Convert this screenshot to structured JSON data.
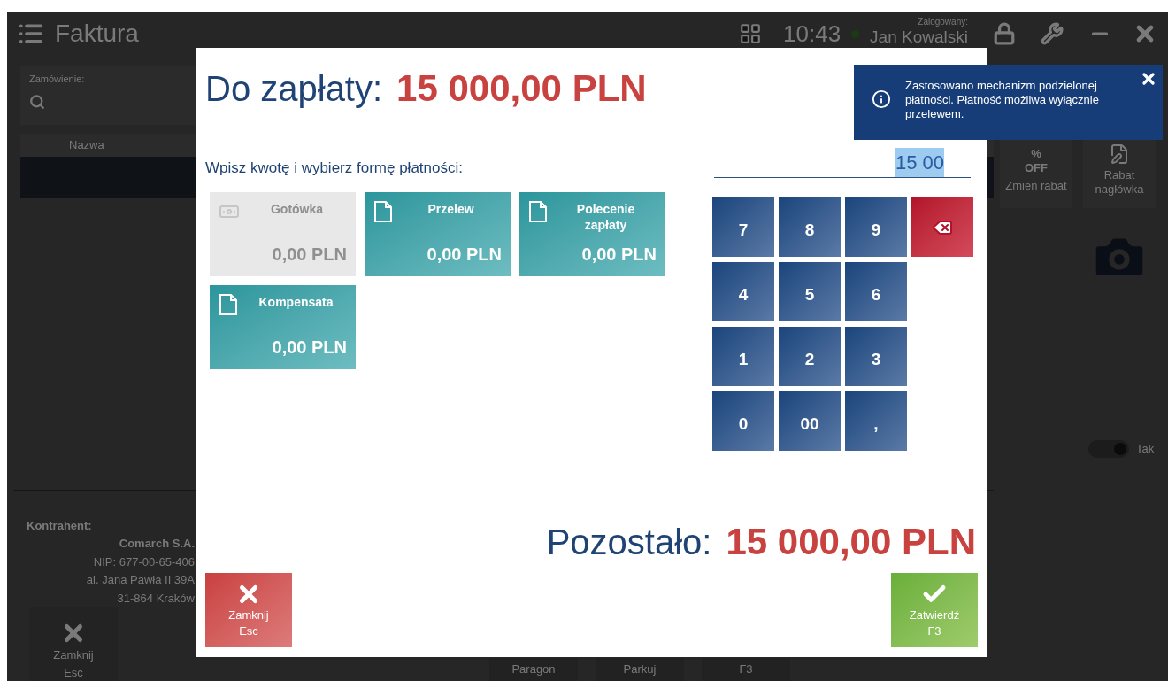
{
  "app": {
    "title": "Faktura",
    "clock": "10:43",
    "user_label": "Zalogowany:",
    "user": "Jan Kowalski",
    "order": {
      "label": "Zamówienie:"
    },
    "table": {
      "columns": [
        "Nazwa"
      ]
    },
    "side_buttons": [
      {
        "kind": "discount",
        "icon_text": [
          "%",
          "OFF"
        ],
        "label": "Zmień rabat"
      },
      {
        "kind": "document",
        "label": "Rabat nagłówka"
      }
    ],
    "toggle": {
      "label": "Tak",
      "on": true
    },
    "customer": {
      "heading": "Kontrahent:",
      "name": "Comarch S.A.",
      "lines": [
        "NIP: 677-00-65-406",
        "al. Jana Pawła II 39A",
        "31-864 Kraków"
      ]
    },
    "close_button": {
      "label": "Zamknij",
      "shortcut": "Esc"
    },
    "bottom_buttons": [
      {
        "label": "Paragon"
      },
      {
        "label": "Parkuj"
      },
      {
        "label": "F3"
      }
    ]
  },
  "dialog": {
    "due_label": "Do zapłaty:",
    "due_amount": "15 000,00",
    "due_currency": "PLN",
    "instruction": "Wpisz kwotę i wybierz formę płatności:",
    "methods": [
      {
        "name": "Gotówka",
        "amount": "0,00 PLN",
        "kind": "cash",
        "disabled": true
      },
      {
        "name": "Przelew",
        "amount": "0,00 PLN",
        "kind": "document",
        "disabled": false
      },
      {
        "name": "Polecenie zapłaty",
        "amount": "0,00 PLN",
        "kind": "document",
        "disabled": false
      },
      {
        "name": "Kompensata",
        "amount": "0,00 PLN",
        "kind": "document",
        "disabled": false
      }
    ],
    "amount_input": {
      "value": "15 00",
      "selected": true
    },
    "keypad": [
      [
        {
          "kind": "digit",
          "label": "7"
        },
        {
          "kind": "digit",
          "label": "8"
        },
        {
          "kind": "digit",
          "label": "9"
        },
        {
          "kind": "backspace"
        }
      ],
      [
        {
          "kind": "digit",
          "label": "4"
        },
        {
          "kind": "digit",
          "label": "5"
        },
        {
          "kind": "digit",
          "label": "6"
        }
      ],
      [
        {
          "kind": "digit",
          "label": "1"
        },
        {
          "kind": "digit",
          "label": "2"
        },
        {
          "kind": "digit",
          "label": "3"
        }
      ],
      [
        {
          "kind": "digit",
          "label": "0"
        },
        {
          "kind": "digit",
          "label": "00"
        },
        {
          "kind": "digit",
          "label": ","
        }
      ]
    ],
    "remaining_label": "Pozostało:",
    "remaining_amount": "15 000,00",
    "remaining_currency": "PLN",
    "buttons": [
      {
        "kind": "cancel",
        "label": "Zamknij",
        "shortcut": "Esc"
      },
      {
        "kind": "confirm",
        "label": "Zatwierdź",
        "shortcut": "F3"
      }
    ]
  },
  "notification": {
    "text": "Zastosowano mechanizm podzielonej płatności. Płatność możliwa wyłącznie przelewem."
  }
}
